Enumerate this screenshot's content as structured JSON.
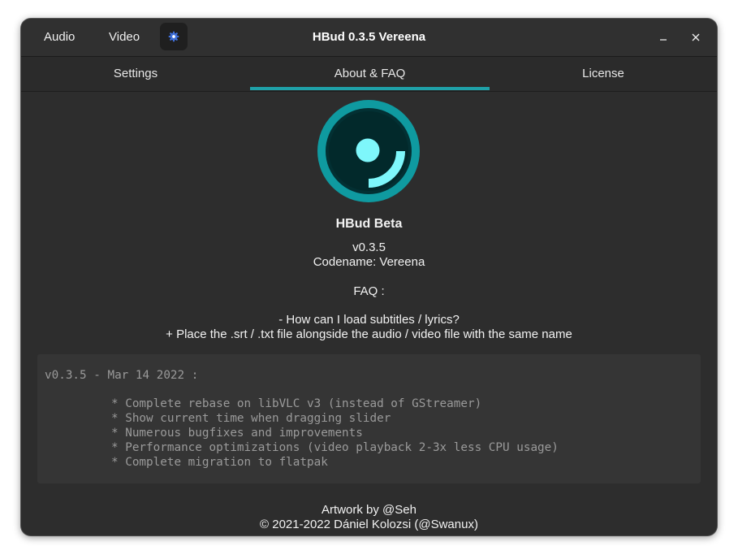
{
  "titlebar": {
    "menu_audio": "Audio",
    "menu_video": "Video",
    "settings_icon": "gear-icon",
    "title": "HBud 0.3.5 Vereena"
  },
  "tabs": [
    {
      "label": "Settings",
      "active": false
    },
    {
      "label": "About & FAQ",
      "active": true
    },
    {
      "label": "License",
      "active": false
    }
  ],
  "about": {
    "app_name": "HBud Beta",
    "version": "v0.3.5",
    "codename": "Codename: Vereena",
    "faq_heading": "FAQ :",
    "faq_question": "- How can I load subtitles / lyrics?",
    "faq_answer": "+ Place the .srt / .txt file alongside the audio / video file with the same name"
  },
  "changelog": {
    "header": "v0.3.5 - Mar 14 2022 :",
    "items": [
      "* Complete rebase on libVLC v3 (instead of GStreamer)",
      "* Show current time when dragging slider",
      "* Numerous bugfixes and improvements",
      "* Performance optimizations (video playback 2-3x less CPU usage)",
      "* Complete migration to flatpak"
    ]
  },
  "footer": {
    "artwork": "Artwork by @Seh",
    "copyright": "© 2021-2022 Dániel Kolozsi (@Swanux)"
  },
  "colors": {
    "accent": "#1fa1a8",
    "logo_ring": "#0f9aa0",
    "logo_fill": "#033033",
    "logo_mark": "#7ef7fb"
  }
}
